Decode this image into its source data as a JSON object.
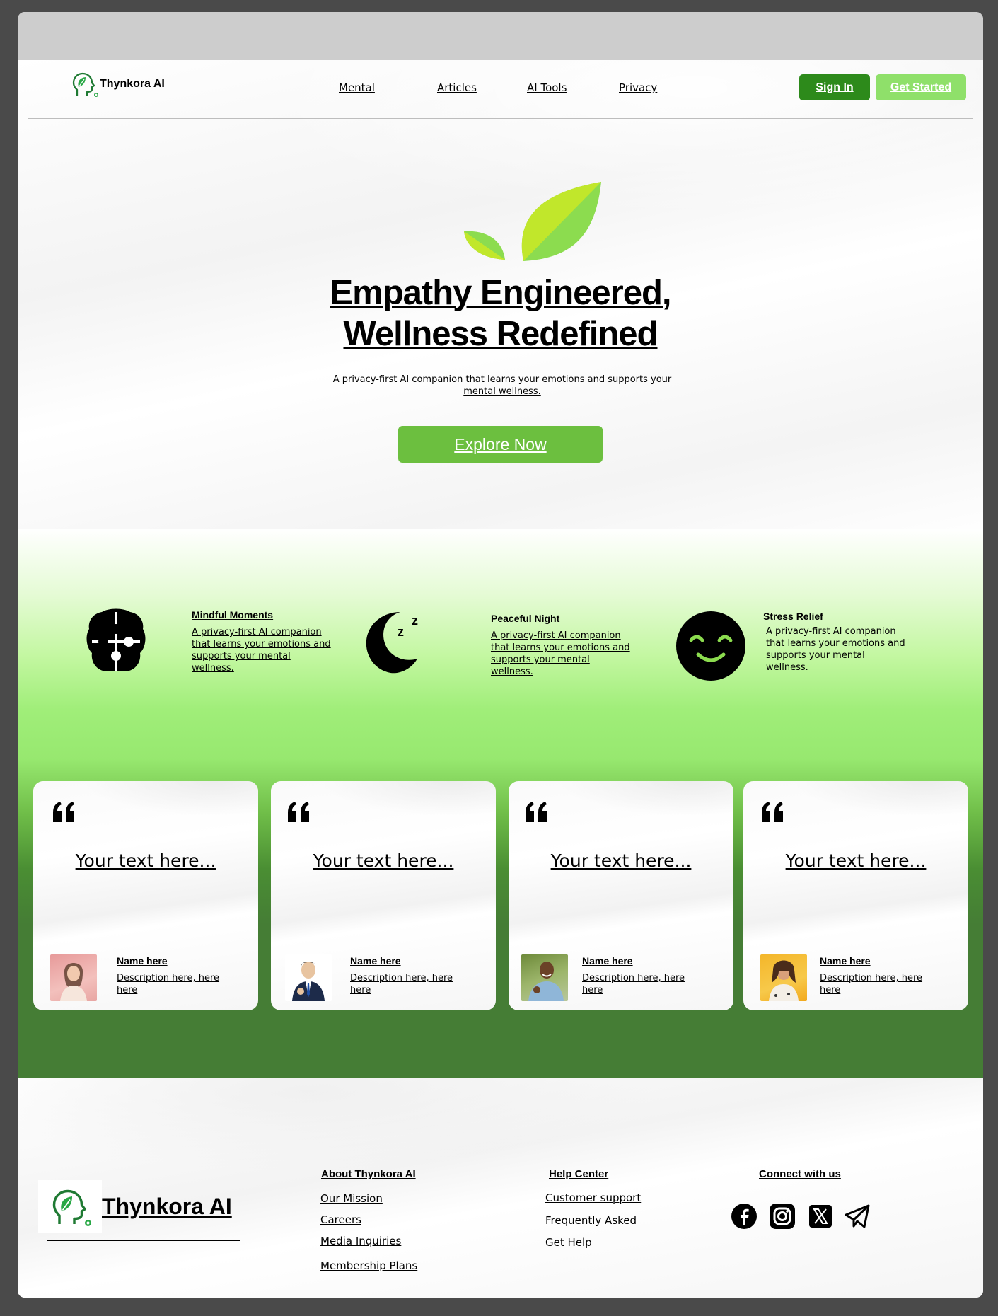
{
  "nav": {
    "brand": "Thynkora AI",
    "links": [
      "Mental",
      "Articles",
      "AI Tools",
      "Privacy"
    ],
    "sign_in": "Sign In",
    "get_started": "Get Started"
  },
  "hero": {
    "title_line1": "Empathy Engineered,",
    "title_line2": "Wellness Redefined",
    "subtitle": "A privacy-first AI companion that learns your emotions and supports your mental wellness.",
    "cta": "Explore Now"
  },
  "features": [
    {
      "title": "Mindful Moments",
      "desc": "A privacy-first AI companion that learns your emotions and supports your mental wellness.",
      "icon": "brain-puzzle-icon"
    },
    {
      "title": "Peaceful Night",
      "desc": "A privacy-first AI companion that learns your emotions and supports your mental wellness.",
      "icon": "moon-sleep-icon"
    },
    {
      "title": "Stress Relief",
      "desc": "A privacy-first AI companion that learns your emotions and supports your mental wellness.",
      "icon": "smile-face-icon"
    }
  ],
  "testimonials": [
    {
      "text": "Your text here...",
      "name": "Name here",
      "desc": "Description here, here here"
    },
    {
      "text": "Your text here...",
      "name": "Name here",
      "desc": "Description here, here here"
    },
    {
      "text": "Your text here...",
      "name": "Name here",
      "desc": "Description here, here here"
    },
    {
      "text": "Your text here...",
      "name": "Name here",
      "desc": "Description here, here here"
    }
  ],
  "footer": {
    "brand": "Thynkora AI",
    "col1": {
      "title": "About Thynkora AI",
      "links": [
        "Our Mission",
        "Careers",
        "Media Inquiries",
        "Membership Plans"
      ]
    },
    "col2": {
      "title": "Help Center",
      "links": [
        "Customer support",
        "Frequently Asked",
        "Get Help"
      ]
    },
    "col3": {
      "title": "Connect with us",
      "socials": [
        "facebook-icon",
        "instagram-icon",
        "x-icon",
        "telegram-icon"
      ]
    }
  },
  "colors": {
    "primary_green": "#2d8a1b",
    "light_green": "#8fe06a",
    "cta_green": "#6cbf3f",
    "dark_band": "#457d35"
  }
}
